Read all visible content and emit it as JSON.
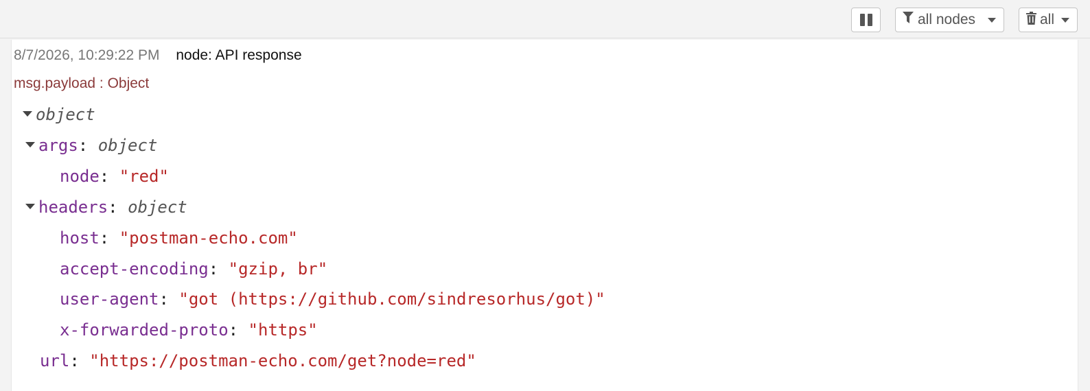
{
  "toolbar": {
    "filter_label": "all nodes",
    "clear_label": "all",
    "icons": [
      "pause-icon",
      "filter-icon",
      "trash-icon",
      "chevron-down-icon"
    ]
  },
  "message": {
    "timestamp": "8/7/2026, 10:29:22 PM",
    "node": "node: API response",
    "topic": "msg.payload : Object",
    "tree": {
      "root_type": "object",
      "args_key": "args",
      "args_type": "object",
      "args_node_key": "node",
      "args_node_value": "\"red\"",
      "headers_key": "headers",
      "headers_type": "object",
      "host_key": "host",
      "host_value": "\"postman-echo.com\"",
      "accept_encoding_key": "accept-encoding",
      "accept_encoding_value": "\"gzip, br\"",
      "user_agent_key": "user-agent",
      "user_agent_value": "\"got (https://github.com/sindresorhus/got)\"",
      "x_forwarded_proto_key": "x-forwarded-proto",
      "x_forwarded_proto_value": "\"https\"",
      "url_key": "url",
      "url_value": "\"https://postman-echo.com/get?node=red\""
    }
  },
  "colors": {
    "key": "#792e90",
    "string": "#b72828",
    "topic": "#8b3a3a",
    "timestamp": "#777777"
  }
}
